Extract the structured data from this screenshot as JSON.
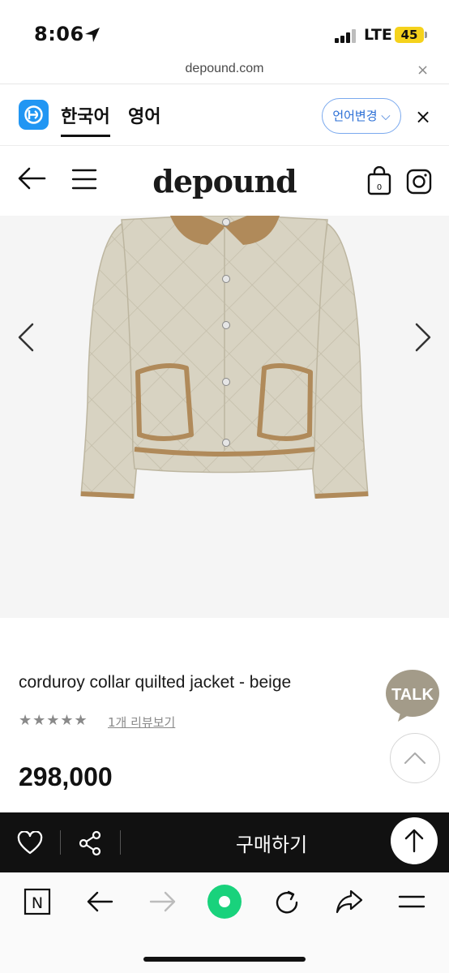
{
  "status_bar": {
    "time": "8:06",
    "network": "LTE",
    "battery": "45"
  },
  "url_bar": {
    "url": "depound.com",
    "close_icon": "×"
  },
  "translate_bar": {
    "lang_current": "한국어",
    "lang_target": "영어",
    "change_label": "언어변경 ⌵",
    "close_icon": "×"
  },
  "site_header": {
    "brand": "depound",
    "cart_count": "0"
  },
  "product": {
    "title": "corduroy collar quilted jacket - beige",
    "rating": 5,
    "stars": "★★★★★",
    "review_link": "1개 리뷰보기",
    "price": "298,000"
  },
  "floating": {
    "talk_label": "TALK"
  },
  "buy_bar": {
    "buy_label": "구매하기"
  },
  "toolbar": {
    "n_label": "N"
  },
  "colors": {
    "accent_blue": "#2196f3",
    "talk_bubble": "#a39b89",
    "jacket": "#d8d3c2",
    "trim": "#b08a5a",
    "reload_green": "#19d27c"
  }
}
